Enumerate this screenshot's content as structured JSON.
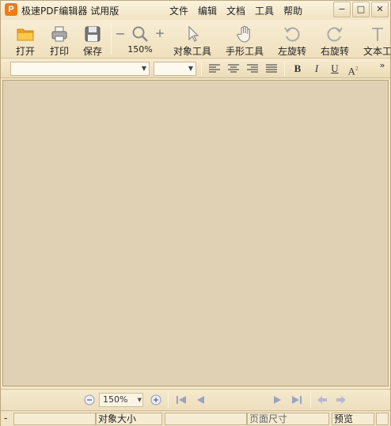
{
  "app": {
    "logo_letter": "P",
    "title": "极速PDF编辑器 试用版"
  },
  "menu": [
    "文件",
    "编辑",
    "文档",
    "工具",
    "帮助"
  ],
  "window_controls": {
    "minimize": "−",
    "maximize": "□",
    "close": "✕"
  },
  "toolbar": {
    "open": "打开",
    "print": "打印",
    "save": "保存",
    "zoom_out": "−",
    "zoom_in": "+",
    "zoom_level": "150%",
    "object_tool": "对象工具",
    "hand_tool": "手形工具",
    "rotate_left": "左旋转",
    "rotate_right": "右旋转",
    "text_tool": "文本工"
  },
  "format": {
    "font_value": "",
    "size_value": "",
    "bold": "B",
    "italic": "I",
    "underline": "U",
    "superscript": "A",
    "superscript_mark": "2",
    "overflow": "»"
  },
  "navbar": {
    "zoom_value": "150%"
  },
  "status": {
    "dash": "-",
    "object_size": "对象大小",
    "page_size": "页面尺寸",
    "preview": "预览"
  },
  "colors": {
    "accent": "#f07c12",
    "canvas": "#e0d1b4"
  }
}
